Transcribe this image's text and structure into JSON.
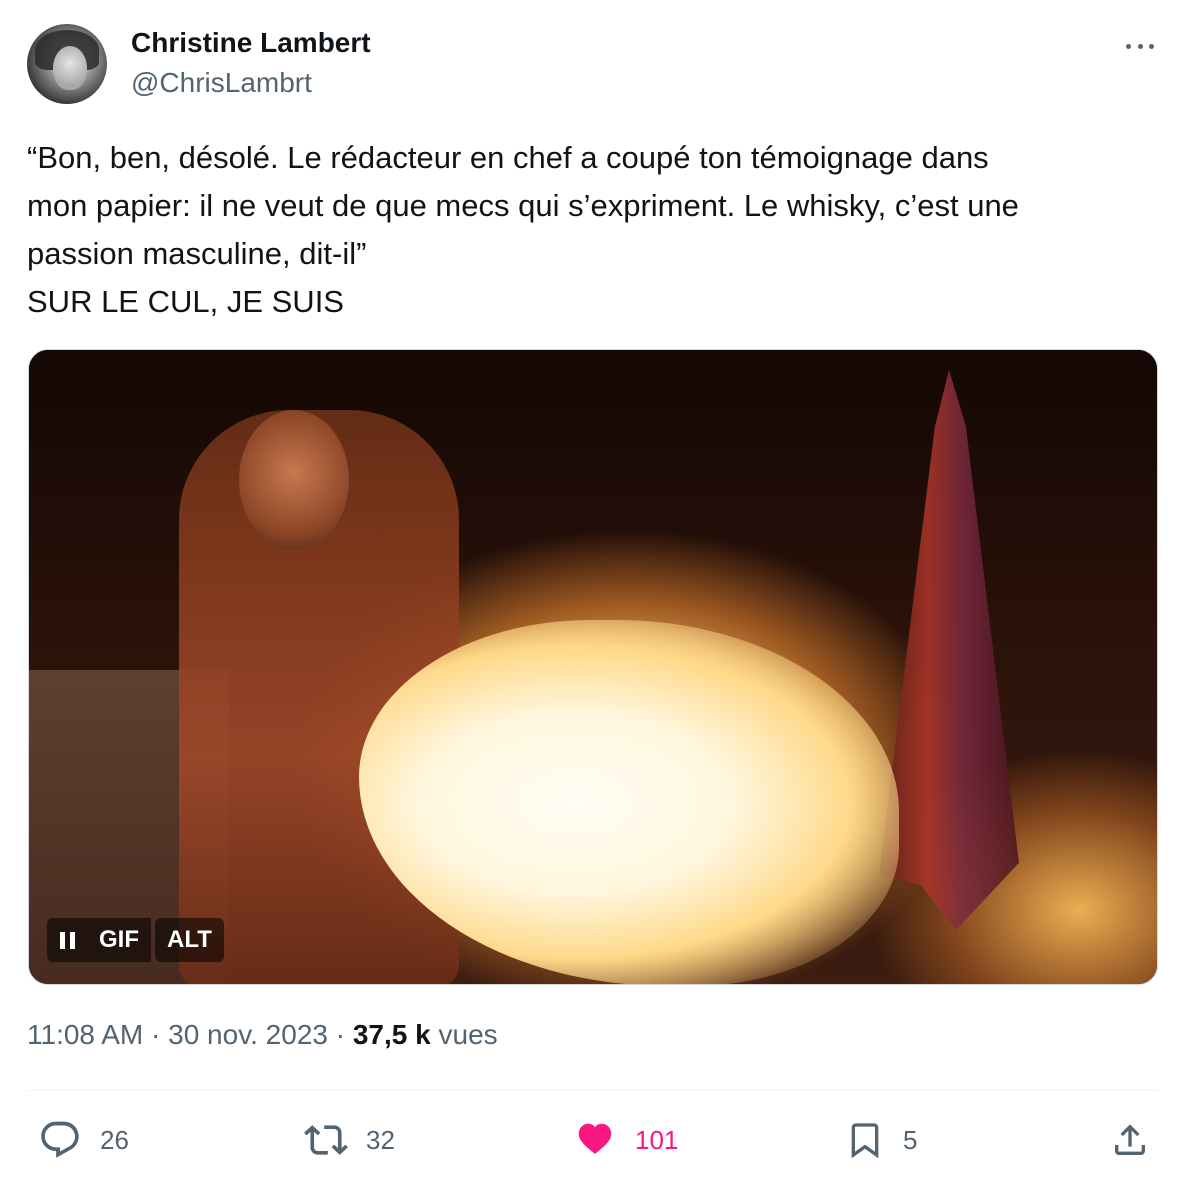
{
  "author": {
    "display_name": "Christine Lambert",
    "handle": "@ChrisLambrt"
  },
  "tweet": {
    "lines": [
      "“Bon, ben, désolé. Le rédacteur en chef a coupé ton témoignage dans",
      "mon papier: il ne veut de que mecs qui s’expriment. Le whisky, c’est une",
      "passion masculine, dit-il”",
      "SUR LE CUL, JE SUIS"
    ]
  },
  "media": {
    "gif_label": "GIF",
    "alt_label": "ALT"
  },
  "meta": {
    "time": "11:08 AM",
    "separator": "·",
    "date": "30 nov. 2023",
    "views_count": "37,5 k",
    "views_label": "vues"
  },
  "actions": {
    "replies": "26",
    "retweets": "32",
    "likes": "101",
    "bookmarks": "5"
  },
  "colors": {
    "like_active": "#f91880",
    "secondary_text": "#536471",
    "primary_text": "#0f1419"
  }
}
